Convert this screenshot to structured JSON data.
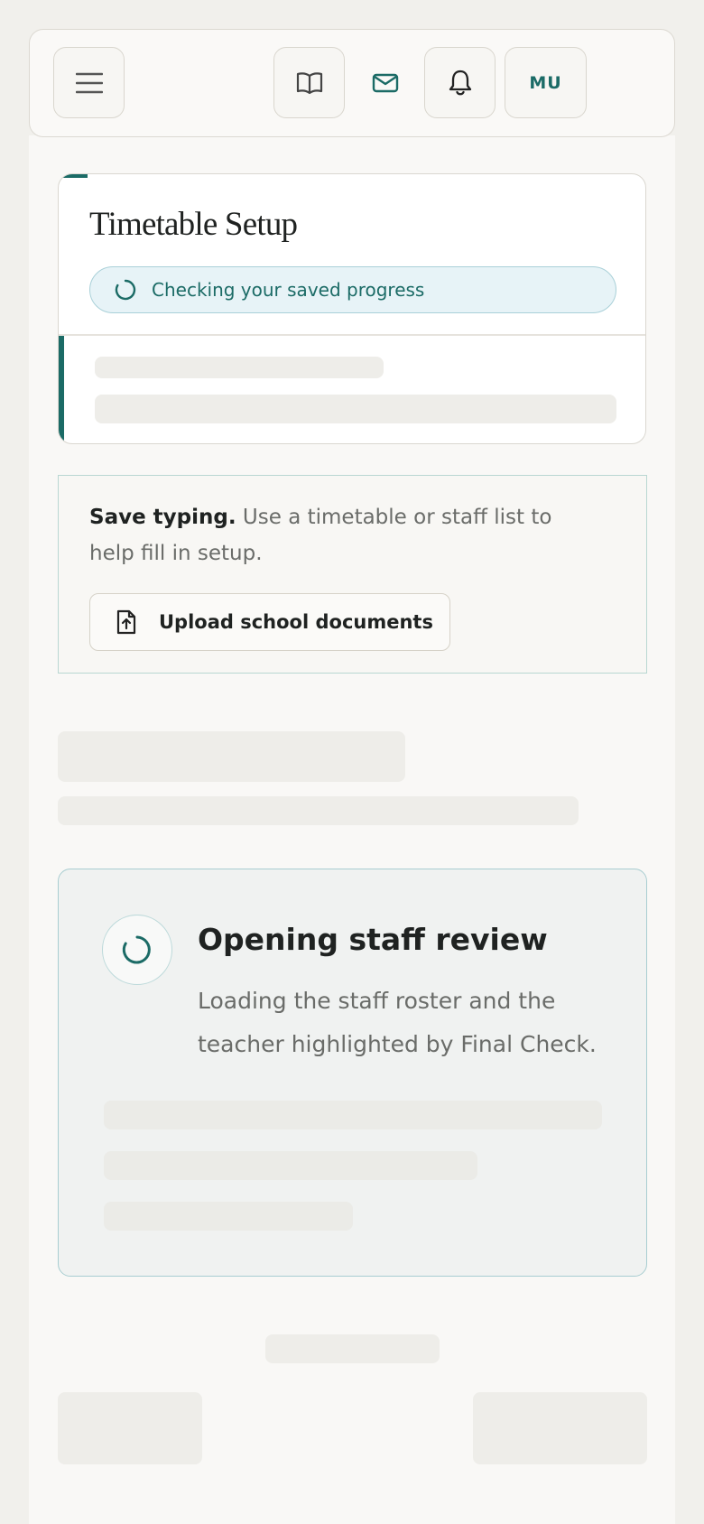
{
  "header": {
    "menu_icon": "menu-icon",
    "guide_icon": "book-open-icon",
    "messages_icon": "mail-icon",
    "notifications_icon": "bell-icon",
    "avatar_initials": "MU"
  },
  "setup_card": {
    "title": "Timetable Setup",
    "status_text": "Checking your saved progress",
    "status_icon": "loading-spinner-icon"
  },
  "upload_card": {
    "lead": "Save typing.",
    "text": " Use a timetable or staff list to help fill in setup.",
    "button_label": "Upload school documents",
    "button_icon": "file-upload-icon"
  },
  "review_card": {
    "title": "Opening staff review",
    "description": "Loading the staff roster and the teacher highlighted by Final Check.",
    "icon": "loading-spinner-icon"
  },
  "colors": {
    "accent": "#1b6b66",
    "background": "#f1f0ec",
    "status_bg": "#e7f3f7"
  }
}
